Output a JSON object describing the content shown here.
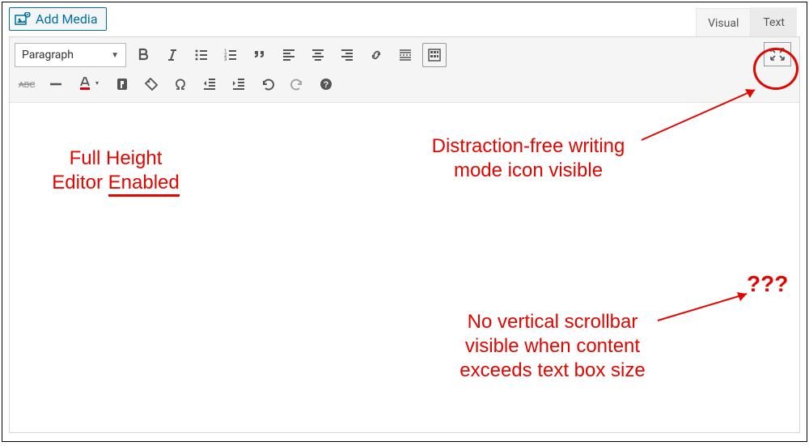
{
  "topbar": {
    "add_media_label": "Add Media"
  },
  "tabs": {
    "visual": "Visual",
    "text": "Text"
  },
  "toolbar": {
    "format_select": "Paragraph"
  },
  "icons": {
    "bold": "bold-icon",
    "italic": "italic-icon",
    "bullet_list": "bullet-list-icon",
    "number_list": "number-list-icon",
    "blockquote": "blockquote-icon",
    "align_left": "align-left-icon",
    "align_center": "align-center-icon",
    "align_right": "align-right-icon",
    "link": "link-icon",
    "read_more": "read-more-icon",
    "toolbar_toggle": "toolbar-toggle-icon",
    "distraction_free": "distraction-free-icon",
    "strikethrough": "strikethrough-icon",
    "hr": "horizontal-rule-icon",
    "text_color": "text-color-icon",
    "clear_formatting": "clear-formatting-icon",
    "tag": "price-tag-icon",
    "special_char": "special-char-icon",
    "outdent": "outdent-icon",
    "indent": "indent-icon",
    "undo": "undo-icon",
    "redo": "redo-icon",
    "help": "help-icon"
  },
  "annotations": {
    "full_height_line1": "Full Height",
    "full_height_line2_a": "Editor ",
    "full_height_line2_b": "Enabled",
    "df_line1": "Distraction-free writing",
    "df_line2": "mode icon visible",
    "scroll_line1": "No vertical scrollbar",
    "scroll_line2": "visible when content",
    "scroll_line3": "exceeds text box size",
    "question": "???"
  }
}
